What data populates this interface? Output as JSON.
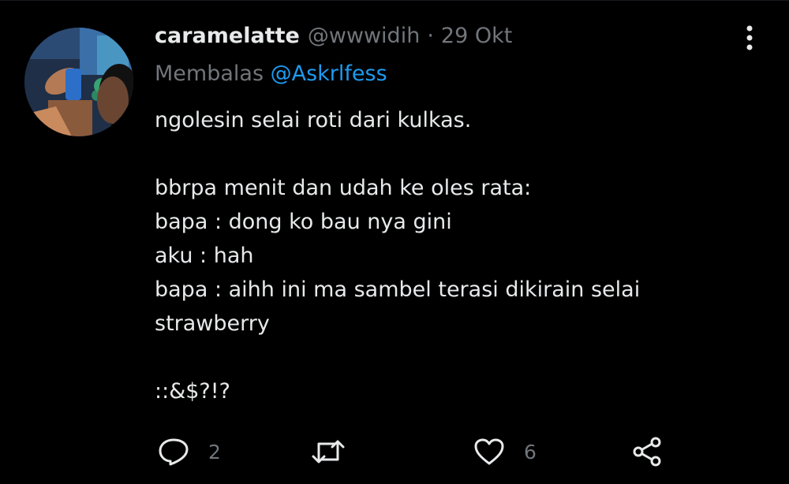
{
  "tweet": {
    "author": {
      "display_name": "caramelatte",
      "handle": "@wwwidih",
      "date": "29 Okt",
      "separator": "·"
    },
    "reply_context": {
      "prefix": "Membalas",
      "mention": "@Askrlfess"
    },
    "body_lines": [
      "ngolesin selai roti dari kulkas.",
      "",
      "bbrpa menit dan udah ke oles rata:",
      "bapa : dong ko bau nya gini",
      "aku : hah",
      "bapa : aihh ini ma sambel terasi dikirain selai",
      "strawberry",
      "",
      "::&$?!?"
    ],
    "actions": {
      "reply": {
        "icon": "reply-icon",
        "count": "2"
      },
      "retweet": {
        "icon": "retweet-icon",
        "count": ""
      },
      "like": {
        "icon": "heart-icon",
        "count": "6"
      },
      "share": {
        "icon": "share-icon"
      }
    }
  },
  "colors": {
    "background": "#000000",
    "primary_text": "#e7e9ea",
    "secondary_text": "#71767b",
    "accent": "#1d9bf0"
  }
}
